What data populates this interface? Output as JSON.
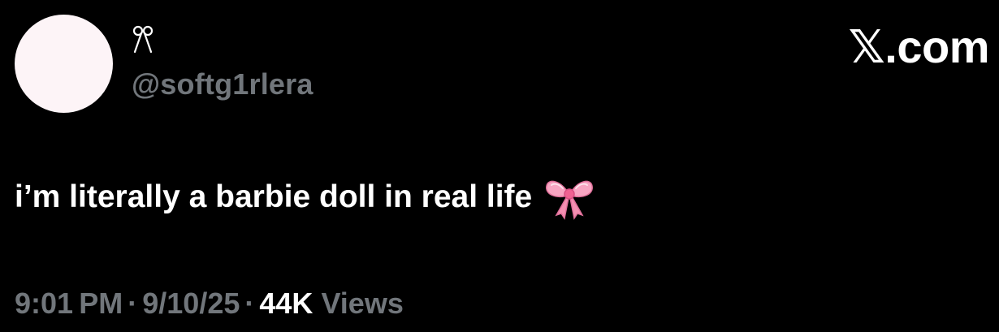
{
  "profile": {
    "display_name": "ⓐ̸̀",
    "display_name_glyph": "ꉂ",
    "handle": "@softg1rlera",
    "avatar_color": "#fdf4f7"
  },
  "brand": {
    "label": "𝕏.com"
  },
  "tweet": {
    "text": "i’m literally a barbie doll in real life",
    "emoji_icon": "pink-ribbon-bow-icon",
    "emoji_color": "#f48fb1"
  },
  "meta": {
    "time": "9:01 PM",
    "separator": "·",
    "date": "9/10/25",
    "views_count": "44K",
    "views_label": "Views"
  },
  "colors": {
    "background": "#000000",
    "text": "#ffffff",
    "secondary": "#71767b"
  }
}
